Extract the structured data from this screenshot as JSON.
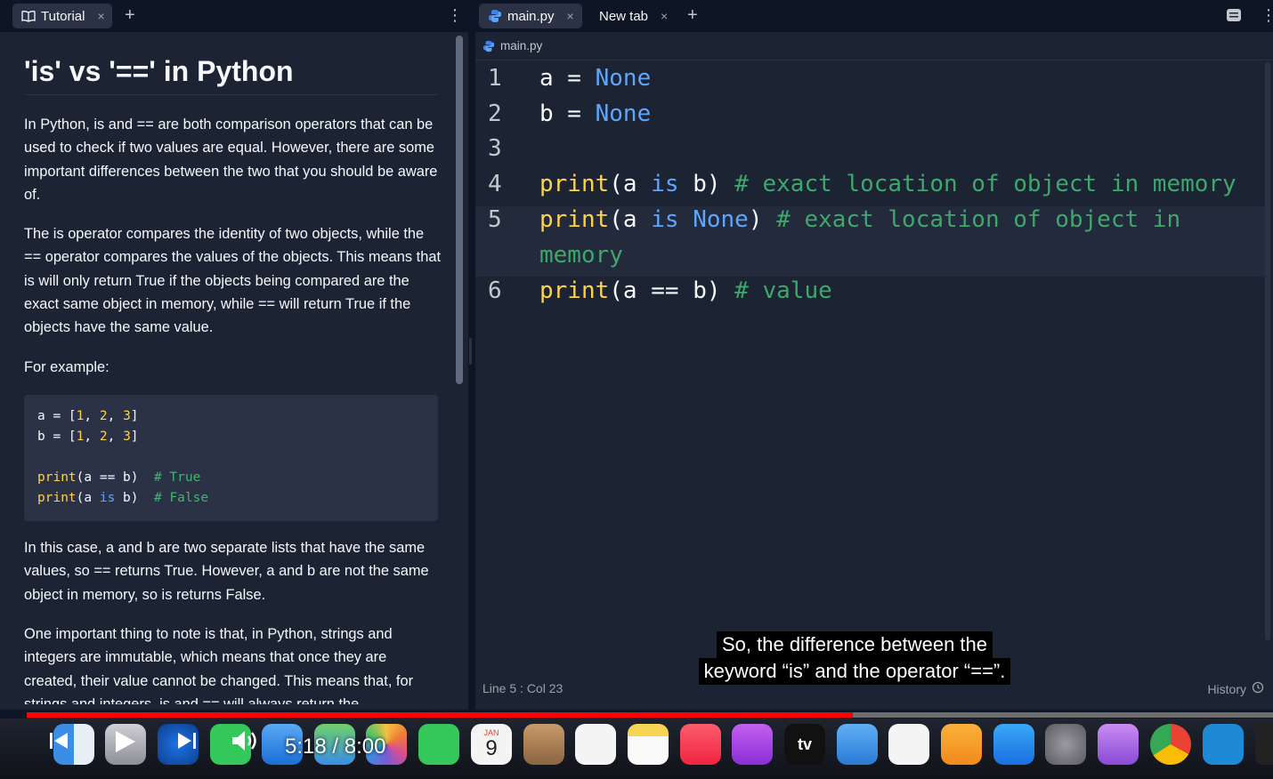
{
  "left_tabs": {
    "active_tab": "Tutorial",
    "close_glyph": "×",
    "add_glyph": "+",
    "menu_glyph": "⋮"
  },
  "tutorial": {
    "title": "'is' vs '==' in Python",
    "para1": "In Python, is and == are both comparison operators that can be used to check if two values are equal. However, there are some important differences between the two that you should be aware of.",
    "para2": "The is operator compares the identity of two objects, while the == operator compares the values of the objects. This means that is will only return True if the objects being compared are the exact same object in memory, while == will return True if the objects have the same value.",
    "para3": "For example:",
    "code_lines": [
      {
        "a": "a = [",
        "n1": "1",
        "s1": ", ",
        "n2": "2",
        "s2": ", ",
        "n3": "3",
        "e": "]"
      },
      {
        "a": "b = [",
        "n1": "1",
        "s1": ", ",
        "n2": "2",
        "s2": ", ",
        "n3": "3",
        "e": "]"
      }
    ],
    "code_print1": {
      "fn": "print",
      "rest": "(a == b)  ",
      "comment": "# True"
    },
    "code_print2": {
      "fn": "print",
      "pre": "(a ",
      "kw": "is",
      "post": " b)  ",
      "comment": "# False"
    },
    "para4": "In this case, a and b are two separate lists that have the same values, so == returns True. However, a and b are not the same object in memory, so is returns False.",
    "para5": "One important thing to note is that, in Python, strings and integers are immutable, which means that once they are created, their value cannot be changed. This means that, for strings and integers, is and == will always return the"
  },
  "right_tabs": {
    "tab1": "main.py",
    "tab2": "New tab",
    "close_glyph": "×",
    "add_glyph": "+",
    "menu_glyph": "⋮"
  },
  "breadcrumb": {
    "file": "main.py"
  },
  "editor": {
    "lines": [
      {
        "num": "1"
      },
      {
        "num": "2"
      },
      {
        "num": "3"
      },
      {
        "num": "4"
      },
      {
        "num": "5"
      },
      {
        "num": "6"
      }
    ],
    "l1": {
      "a": "a = ",
      "kw": "None"
    },
    "l2": {
      "a": "b = ",
      "kw": "None"
    },
    "l4": {
      "fn": "print",
      "pre": "(a ",
      "kw": "is",
      "post": " b) ",
      "comment": "# exact location of object in memory"
    },
    "l5": {
      "fn": "print",
      "pre": "(a ",
      "kw": "is",
      "mid": " ",
      "kw2": "None",
      "post": ") ",
      "comment": "# exact location of object in",
      "comment_wrap": "memory"
    },
    "l6": {
      "fn": "print",
      "rest": "(a == b) ",
      "comment": "# value"
    }
  },
  "status": {
    "position": "Line 5 : Col 23",
    "history": "History"
  },
  "caption": {
    "line1": "So, the difference between the",
    "line2": "keyword “is” and the operator “==”."
  },
  "video": {
    "time": "5:18 / 8:00",
    "progress": 0.6625
  },
  "dock": {
    "calendar_month": "JAN",
    "calendar_day": "9",
    "appletv_label": "tv"
  },
  "colors": {
    "accent_red": "#ff0000",
    "python_blue": "#3b82f6",
    "keyword": "#60a5fa",
    "function": "#fcd34d",
    "comment": "#3ea76b"
  }
}
